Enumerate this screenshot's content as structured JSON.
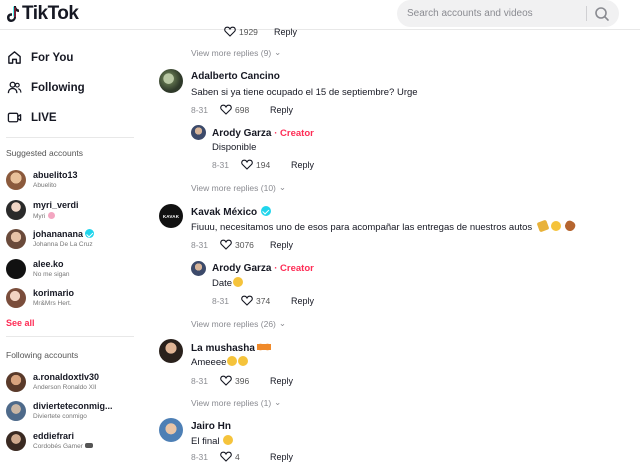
{
  "app": {
    "logo_text": "TikTok"
  },
  "search": {
    "placeholder": "Search accounts and videos"
  },
  "nav": [
    {
      "label": "For You",
      "icon": "home-icon"
    },
    {
      "label": "Following",
      "icon": "users-icon"
    },
    {
      "label": "LIVE",
      "icon": "live-icon"
    }
  ],
  "suggested": {
    "title": "Suggested accounts",
    "accounts": [
      {
        "username": "abuelito13",
        "name": "Abuelito",
        "verified": false
      },
      {
        "username": "myri_verdi",
        "name": "Myri",
        "verified": false
      },
      {
        "username": "johananana",
        "name": "Johanna De La Cruz",
        "verified": true
      },
      {
        "username": "alee.ko",
        "name": "No me sigan",
        "verified": false
      },
      {
        "username": "korimario",
        "name": "Mr&Mrs Hert.",
        "verified": false
      }
    ],
    "see_all": "See all"
  },
  "following": {
    "title": "Following accounts",
    "accounts": [
      {
        "username": "a.ronaldoxtlv30",
        "name": "Anderson Ronaldo XII"
      },
      {
        "username": "diviertete­conmig...",
        "name": "Diviertete conmigo"
      },
      {
        "username": "eddiefrari",
        "name": "Cordobés Gamer"
      }
    ]
  },
  "comments": {
    "top_partial": {
      "likes": "1929",
      "reply": "Reply"
    },
    "items": [
      {
        "view_more_before": "View more replies (9)",
        "author": "Adalberto Cancino",
        "text": "Saben si ya tiene ocupado el 15 de septiembre? Urge",
        "date": "8-31",
        "likes": "698",
        "reply": "Reply",
        "sub": {
          "author": "Arody Garza",
          "badge": "· Creator",
          "text": "Disponible",
          "date": "8-31",
          "likes": "194",
          "reply": "Reply"
        },
        "view_more_after": "View more replies (10)"
      },
      {
        "author": "Kavak México",
        "verified": true,
        "avatar_text": "KAVAK",
        "text": "Fiuuu, necesitamos uno de esos para acompañar las entregas de nuestros autos",
        "date": "8-31",
        "likes": "3076",
        "reply": "Reply",
        "sub": {
          "author": "Arody Garza",
          "badge": "· Creator",
          "text": "Date",
          "date": "8-31",
          "likes": "374",
          "reply": "Reply"
        },
        "view_more_after": "View more replies (26)"
      },
      {
        "author": "La mushasha",
        "text": "Ameeee",
        "date": "8-31",
        "likes": "396",
        "reply": "Reply",
        "view_more_after": "View more replies (1)"
      },
      {
        "author": "Jairo Hn",
        "text": "El final",
        "date": "8-31",
        "likes": "4",
        "reply": "Reply"
      }
    ]
  },
  "colors": {
    "accent": "#fe2c55",
    "verified": "#20d5ec",
    "muted": "#8a8b91"
  }
}
